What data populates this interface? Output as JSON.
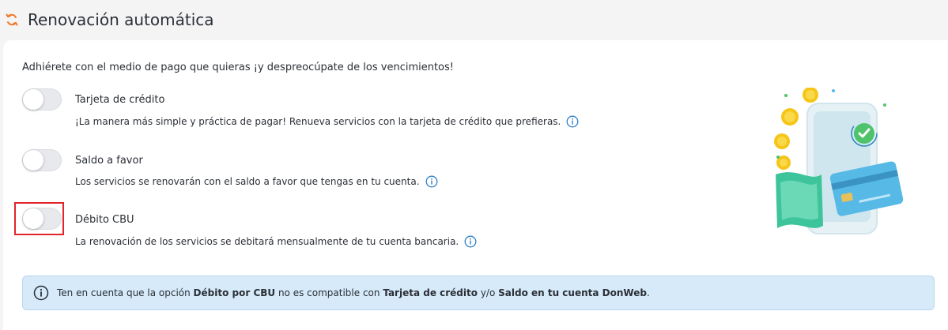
{
  "header": {
    "title": "Renovación automática",
    "icon": "renew-icon"
  },
  "intro": "Adhiérete con el medio de pago que quieras ¡y despreocúpate de los vencimientos!",
  "options": [
    {
      "title": "Tarjeta de crédito",
      "description": "¡La manera más simple y práctica de pagar! Renueva servicios con la tarjeta de crédito que prefieras.",
      "enabled": false
    },
    {
      "title": "Saldo a favor",
      "description": "Los servicios se renovarán con el saldo a favor que tengas en tu cuenta.",
      "enabled": false
    },
    {
      "title": "Débito CBU",
      "description": "La renovación de los servicios se debitará mensualmente de tu cuenta bancaria.",
      "enabled": false
    }
  ],
  "notice": {
    "part1": "Ten en cuenta que la opción ",
    "bold1": "Débito por CBU",
    "part2": " no es compatible con ",
    "bold2": "Tarjeta de crédito",
    "part3": " y/o ",
    "bold3": "Saldo en tu cuenta DonWeb",
    "part4": "."
  },
  "colors": {
    "accent_orange": "#f07a2b",
    "info_blue": "#2f80c9",
    "notice_bg": "#d6eafa",
    "highlight_red": "#e0242a"
  }
}
